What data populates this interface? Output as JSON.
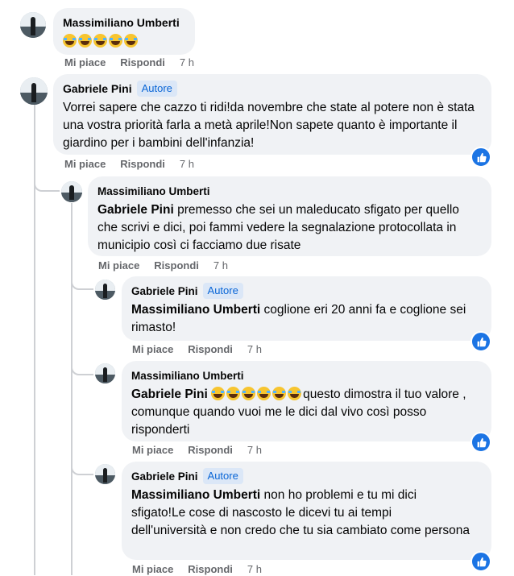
{
  "comments": [
    {
      "author": "Massimiliano Umberti",
      "text": "",
      "emoji_count": 5,
      "actions": {
        "like": "Mi piace",
        "reply": "Rispondi",
        "time": "7 h"
      }
    },
    {
      "author": "Gabriele Pini",
      "badge": "Autore",
      "text": "Vorrei sapere che cazzo ti ridi!da novembre che state al potere non è stata una vostra priorità farla a metà aprile!Non sapete quanto è importante il giardino per i bambini dell'infanzia!",
      "reactions": "like-icon",
      "actions": {
        "like": "Mi piace",
        "reply": "Rispondi",
        "time": "7 h"
      }
    },
    {
      "author": "Massimiliano Umberti",
      "mention": "Gabriele Pini",
      "text": " premesso che sei un maleducato sfigato per quello che scrivi e dici, poi fammi vedere la segnalazione protocollata in municipio così ci facciamo due risate",
      "actions": {
        "like": "Mi piace",
        "reply": "Rispondi",
        "time": "7 h"
      }
    },
    {
      "author": "Gabriele Pini",
      "badge": "Autore",
      "mention": "Massimiliano Umberti",
      "text": " coglione eri 20 anni fa e coglione sei rimasto!",
      "reactions": "like-icon",
      "actions": {
        "like": "Mi piace",
        "reply": "Rispondi",
        "time": "7 h"
      }
    },
    {
      "author": "Massimiliano Umberti",
      "mention": "Gabriele Pini",
      "emoji_count": 6,
      "text": "questo dimostra il tuo valore , comunque quando vuoi me le dici dal vivo così posso risponderti",
      "reactions": "like-icon",
      "actions": {
        "like": "Mi piace",
        "reply": "Rispondi",
        "time": "7 h"
      }
    },
    {
      "author": "Gabriele Pini",
      "badge": "Autore",
      "mention": "Massimiliano Umberti",
      "text": " non ho problemi e tu mi dici sfigato!Le cose di nascosto le dicevi tu ai tempi dell'università e non credo che tu sia cambiato come persona",
      "reactions": "like-icon",
      "actions": {
        "like": "Mi piace",
        "reply": "Rispondi",
        "time": "7 h"
      }
    }
  ],
  "colors": {
    "like_blue": "#1b74e4",
    "bubble": "#f0f2f5",
    "author_badge_text": "#0a66d6"
  }
}
